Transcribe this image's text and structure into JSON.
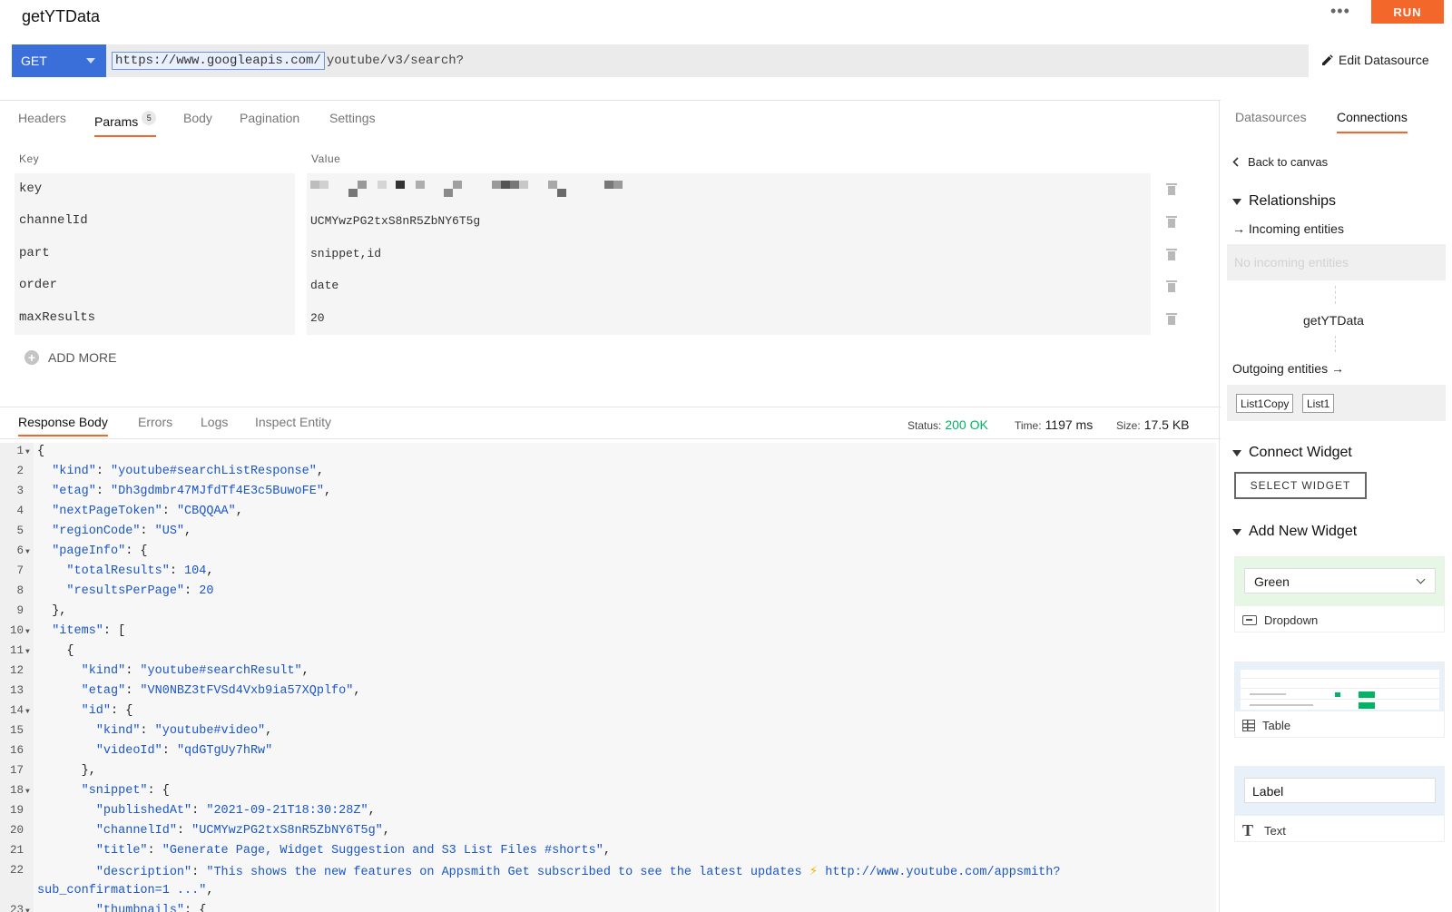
{
  "header": {
    "title": "getYTData",
    "more_icon": "ellipsis-icon",
    "run_label": "RUN",
    "method": "GET",
    "url_base": "https://www.googleapis.com/",
    "url_path": "youtube/v3/search?",
    "edit_datasource_label": "Edit Datasource",
    "accent_color": "#F3672A"
  },
  "request_tabs": {
    "headers": "Headers",
    "params": "Params",
    "params_count": "5",
    "body": "Body",
    "pagination": "Pagination",
    "settings": "Settings"
  },
  "params": {
    "key_header": "Key",
    "value_header": "Value",
    "rows": [
      {
        "key": "key",
        "value": ""
      },
      {
        "key": "channelId",
        "value": "UCMYwzPG2txS8nR5ZbNY6T5g"
      },
      {
        "key": "part",
        "value": "snippet,id"
      },
      {
        "key": "order",
        "value": "date"
      },
      {
        "key": "maxResults",
        "value": "20"
      }
    ],
    "add_more_label": "ADD MORE"
  },
  "response_tabs": {
    "response_body": "Response Body",
    "errors": "Errors",
    "logs": "Logs",
    "inspect_entity": "Inspect Entity"
  },
  "status": {
    "status_label": "Status:",
    "status_value": "200 OK",
    "time_label": "Time:",
    "time_value": "1197 ms",
    "size_label": "Size:",
    "size_value": "17.5 KB",
    "ok_color": "#03B365"
  },
  "right_panel": {
    "tab_datasources": "Datasources",
    "tab_connections": "Connections",
    "back_label": "Back to canvas",
    "relationships_title": "Relationships",
    "incoming_label": "Incoming entities",
    "no_incoming": "No incoming entities",
    "entity_name": "getYTData",
    "outgoing_label": "Outgoing entities",
    "outgoing": [
      "List1Copy",
      "List1"
    ],
    "connect_widget_title": "Connect Widget",
    "select_widget_label": "SELECT WIDGET",
    "add_new_widget_title": "Add New Widget",
    "widgets": {
      "dropdown_preview_value": "Green",
      "dropdown_label": "Dropdown",
      "table_label": "Table",
      "text_preview_value": "Label",
      "text_label": "Text"
    }
  }
}
